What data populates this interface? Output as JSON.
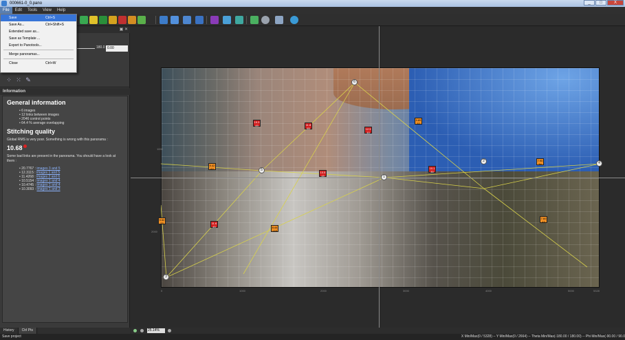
{
  "window": {
    "title": "000661-0_0.pano",
    "controls": [
      "_",
      "□",
      "X"
    ]
  },
  "menu": [
    "File",
    "Edit",
    "Tools",
    "View",
    "Help"
  ],
  "file_menu": {
    "items": [
      {
        "label": "Save",
        "shortcut": "Ctrl+S"
      },
      {
        "label": "Save As...",
        "shortcut": "Ctrl+Shift+S"
      },
      {
        "label": "Extended save as...",
        "shortcut": ""
      },
      {
        "label": "Save as Template ...",
        "shortcut": ""
      },
      {
        "label": "Export to Panotools...",
        "shortcut": ""
      },
      {
        "label": "Merge panoramas...",
        "shortcut": ""
      },
      {
        "label": "Close",
        "shortcut": "Ctrl+W"
      }
    ]
  },
  "left_panel": {
    "slider_value": "180.0",
    "slider_input": "0.00",
    "info_header": "Information",
    "general_title": "General information",
    "general_items": [
      "6 images",
      "12 links between images",
      "2046 control points",
      "64.4 % average overlapping"
    ],
    "stitch_title": "Stitching quality",
    "rms_text": "Global RMS is very poor. Something is wrong with this panorama :",
    "rms_value": "10.68",
    "bad_links_text": "Some bad links are present in the panorama. You should have a look at them :",
    "bad_links": [
      {
        "value": "20.7767",
        "link": "images 3 and 5"
      },
      {
        "value": "12.3115",
        "link": "images 1 and 5"
      },
      {
        "value": "11.4268",
        "link": "images 2 and 6"
      },
      {
        "value": "10.5154",
        "link": "images 1 and 4"
      },
      {
        "value": "10.4745",
        "link": "images 1 and 4"
      },
      {
        "value": "10.3093",
        "link": "images 1 and 3"
      }
    ]
  },
  "bottom_tabs": [
    "History",
    "Ctrl Pts"
  ],
  "zoom_value": "25.14%",
  "status": {
    "text": "Save project",
    "coords": "X Min/Max(0 / 5328)  --  Y Min/Max(0 / 2664)  --  Theta Min/Max(-180.00 / 180.00)  --  Phi Min/Max(-90.00 / 90.0"
  },
  "canvas": {
    "y_axis_labels": [
      "1000",
      "2000"
    ],
    "x_axis_labels": [
      "0",
      "1000",
      "2000",
      "3000",
      "4000",
      "5000",
      "5328"
    ],
    "control_points": [
      "6",
      "5",
      "1",
      "2",
      "4",
      "3"
    ],
    "link_labels": [
      {
        "value": "19.3",
        "sub": "49",
        "color": "red"
      },
      {
        "value": "11.8",
        "sub": "65",
        "color": "red"
      },
      {
        "value": "12.3",
        "sub": "10",
        "color": "red"
      },
      {
        "value": "9.89",
        "sub": "32",
        "color": "orange"
      },
      {
        "value": "9.42",
        "sub": "62",
        "color": "orange"
      },
      {
        "value": "10.5",
        "sub": "19",
        "color": "red"
      },
      {
        "value": "10.1",
        "sub": "30",
        "color": "red"
      },
      {
        "value": "7.90",
        "sub": "34",
        "color": "orange"
      },
      {
        "value": "9.52",
        "sub": "22",
        "color": "orange"
      },
      {
        "value": "11.6",
        "sub": "45",
        "color": "red"
      },
      {
        "value": "8.44",
        "sub": "148",
        "color": "orange"
      },
      {
        "value": "7.60",
        "sub": "43",
        "color": "orange"
      }
    ]
  }
}
